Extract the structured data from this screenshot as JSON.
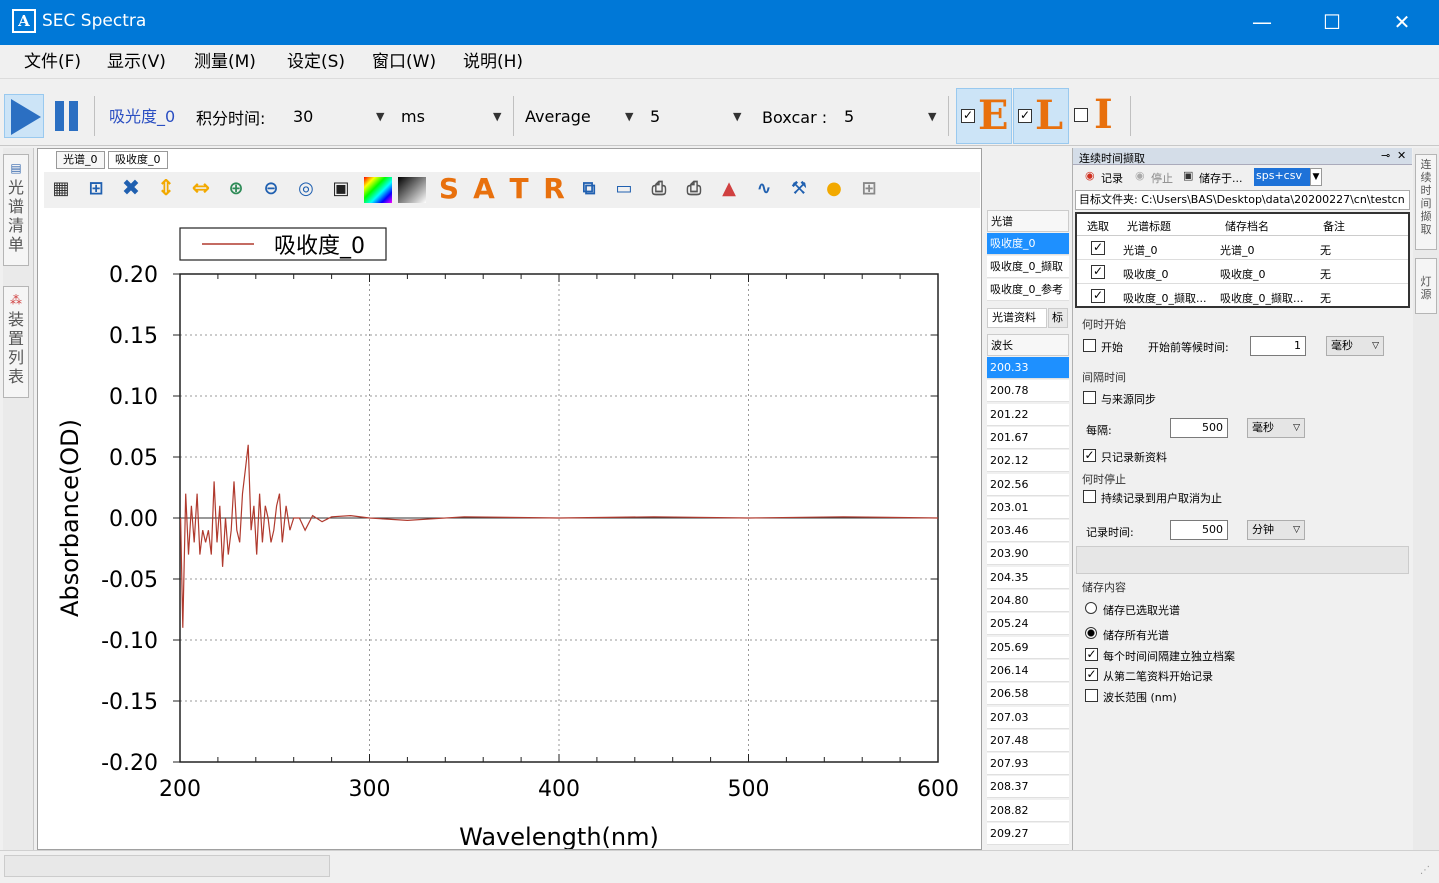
{
  "window": {
    "title": "SEC Spectra",
    "logo_text": "A"
  },
  "window_controls": {
    "minimize": "—",
    "maximize": "☐",
    "close": "✕"
  },
  "menu": [
    "文件(F)",
    "显示(V)",
    "测量(M)",
    "设定(S)",
    "窗口(W)",
    "说明(H)"
  ],
  "toolbar": {
    "spectrum_name": "吸光度_0",
    "integration_label": "积分时间:",
    "integration_value": "30",
    "unit": "ms",
    "average_label": "Average",
    "average_value": "5",
    "boxcar_label": "Boxcar :",
    "boxcar_value": "5",
    "eli": [
      {
        "letter": "E",
        "checked": true
      },
      {
        "letter": "L",
        "checked": true
      },
      {
        "letter": "I",
        "checked": false
      }
    ]
  },
  "left_tabs": [
    "光谱清单",
    "装置列表"
  ],
  "chart_tabs": [
    "光谱_0",
    "吸收度_0"
  ],
  "chart_tools": [
    "S",
    "A",
    "T",
    "R"
  ],
  "chart_data": {
    "type": "line",
    "xlabel": "Wavelength(nm)",
    "ylabel": "Absorbance(OD)",
    "xlim": [
      200,
      600
    ],
    "ylim": [
      -0.2,
      0.2
    ],
    "xticks": [
      "200",
      "300",
      "400",
      "500",
      "600"
    ],
    "yticks": [
      "0.20",
      "0.15",
      "0.10",
      "0.05",
      "0.00",
      "-0.05",
      "-0.10",
      "-0.15",
      "-0.20"
    ],
    "grid": true,
    "legend": "top-left",
    "series": [
      {
        "name": "吸收度_0",
        "color": "#b03a2e",
        "x": [
          200.3,
          201.5,
          203,
          204.5,
          206,
          207.5,
          209,
          210.5,
          212,
          213.5,
          215,
          216.5,
          218,
          219.5,
          221,
          222.5,
          224,
          225.5,
          227,
          228.5,
          230,
          231.5,
          233,
          234.5,
          236,
          237.5,
          239,
          240.5,
          242,
          243.5,
          245,
          246.5,
          248,
          249.5,
          251,
          252.5,
          254,
          256,
          258,
          260,
          263,
          266,
          270,
          275,
          280,
          290,
          300,
          320,
          350,
          400,
          450,
          500,
          550,
          600
        ],
        "y": [
          0.0,
          -0.09,
          0.02,
          -0.03,
          0.01,
          -0.02,
          0.02,
          -0.03,
          -0.01,
          -0.02,
          -0.01,
          -0.03,
          0.03,
          -0.02,
          0.01,
          -0.04,
          0.0,
          -0.03,
          -0.01,
          0.03,
          -0.01,
          -0.02,
          0.02,
          0.04,
          0.06,
          -0.01,
          0.01,
          -0.03,
          0.02,
          -0.02,
          0.01,
          0.0,
          -0.02,
          -0.01,
          0.01,
          0.02,
          -0.02,
          0.01,
          -0.01,
          0.0,
          0.0,
          -0.01,
          0.002,
          -0.003,
          0.001,
          0.002,
          0.0,
          -0.002,
          0.001,
          0.0,
          0.001,
          0.0,
          0.001,
          0.0
        ]
      }
    ]
  },
  "spectrum_list": {
    "header": "光谱",
    "items": [
      "吸收度_0",
      "吸收度_0_撷取",
      "吸收度_0_参考"
    ]
  },
  "data_tabs": [
    "光谱资料",
    "标"
  ],
  "wavelength_list": {
    "header": "波长",
    "values": [
      "200.33",
      "200.78",
      "201.22",
      "201.67",
      "202.12",
      "202.56",
      "203.01",
      "203.46",
      "203.90",
      "204.35",
      "204.80",
      "205.24",
      "205.69",
      "206.14",
      "206.58",
      "207.03",
      "207.48",
      "207.93",
      "208.37",
      "208.82",
      "209.27"
    ]
  },
  "capture_panel": {
    "title": "连续时间撷取",
    "record": "记录",
    "stop": "停止",
    "save_to": "储存于...",
    "format": "sps+csv",
    "target_folder": "目标文件夹: C:\\Users\\BAS\\Desktop\\data\\20200227\\cn\\testcn",
    "table_headers": [
      "选取",
      "光谱标题",
      "储存档名",
      "备注"
    ],
    "rows": [
      {
        "title": "光谱_0",
        "file": "光谱_0",
        "note": "无"
      },
      {
        "title": "吸收度_0",
        "file": "吸收度_0",
        "note": "无"
      },
      {
        "title": "吸收度_0_撷取...",
        "file": "吸收度_0_撷取...",
        "note": "无"
      }
    ],
    "start_group": "何时开始",
    "start_label": "开始",
    "wait_label": "开始前等候时间:",
    "wait_value": "1",
    "wait_unit": "毫秒",
    "interval_group": "间隔时间",
    "sync_label": "与来源同步",
    "every_label": "每隔:",
    "every_value": "500",
    "every_unit": "毫秒",
    "only_new_label": "只记录新资料",
    "stop_group": "何时停止",
    "until_cancel_label": "持续记录到用户取消为止",
    "record_time_label": "记录时间:",
    "record_time_value": "500",
    "record_time_unit": "分钟",
    "save_group": "储存内容",
    "save_selected": "储存已选取光谱",
    "save_all": "储存所有光谱",
    "separate_files": "每个时间间隔建立独立档案",
    "from_second": "从第二笔资料开始记录",
    "wl_range": "波长范围 (nm)"
  },
  "right_tabs": [
    "连续时间撷取",
    "灯源"
  ]
}
